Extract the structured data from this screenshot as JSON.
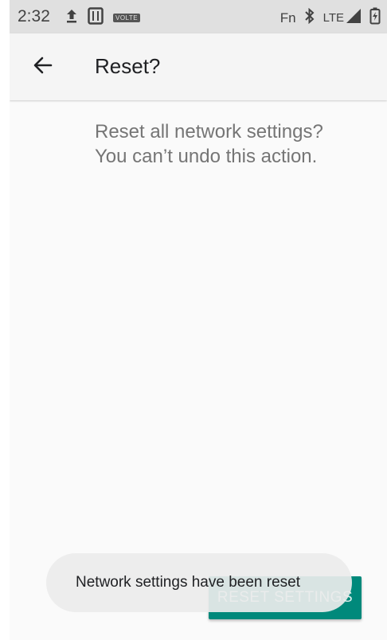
{
  "status_bar": {
    "time": "2:32",
    "volte_label": "VOLTE",
    "fn_label": "Fn",
    "network_label": "LTE"
  },
  "app_bar": {
    "title": "Reset?"
  },
  "content": {
    "message_line1": "Reset all network settings?",
    "message_line2": "You can’t undo this action."
  },
  "actions": {
    "reset_button_label": "RESET SETTINGS"
  },
  "snackbar": {
    "text": "Network settings have been reset"
  },
  "colors": {
    "accent": "#00897b",
    "status_bar_bg": "#e0e0e0",
    "background": "#fafafa"
  },
  "icons": [
    "upload-icon",
    "sim-card-icon",
    "bluetooth-icon",
    "signal-icon",
    "battery-charging-icon",
    "back-arrow-icon"
  ]
}
